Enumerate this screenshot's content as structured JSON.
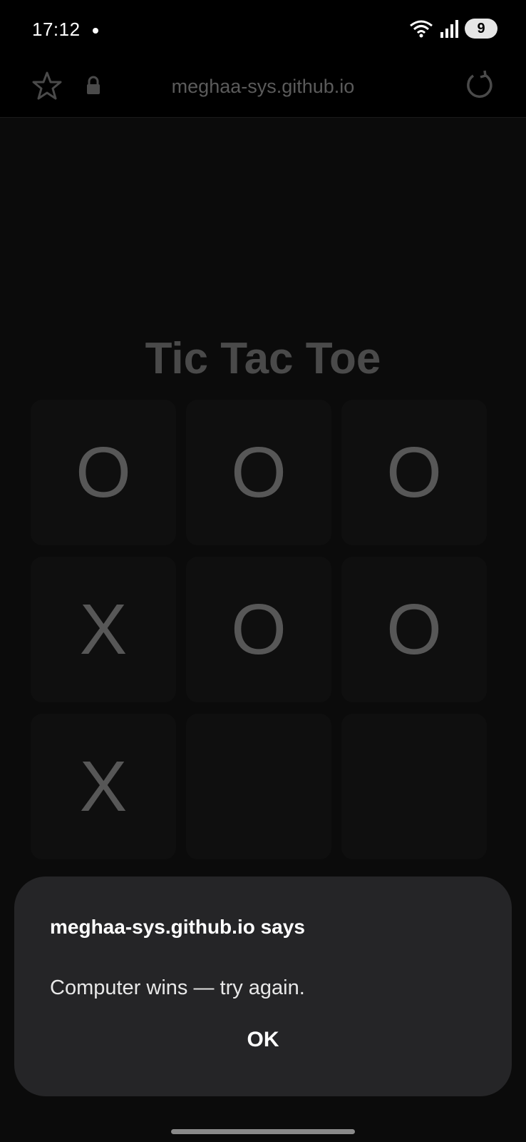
{
  "status_bar": {
    "time": "17:12",
    "battery": "9"
  },
  "browser": {
    "url": "meghaa-sys.github.io"
  },
  "game": {
    "title": "Tic Tac Toe",
    "cells": [
      "O",
      "O",
      "O",
      "X",
      "O",
      "O",
      "X",
      "",
      ""
    ]
  },
  "dialog": {
    "title": "meghaa-sys.github.io says",
    "message": "Computer wins — try again.",
    "ok_label": "OK"
  }
}
